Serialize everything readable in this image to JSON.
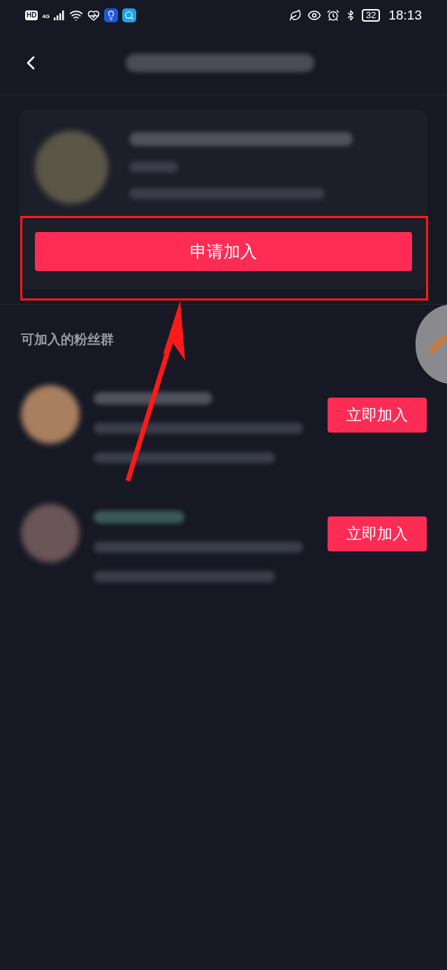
{
  "status_bar": {
    "hd_badge": "HD",
    "network_type": "4G",
    "battery": "32",
    "time": "18:13"
  },
  "group_card": {
    "join_button": "申请加入"
  },
  "section_title": "可加入的粉丝群",
  "groups": [
    {
      "join_button": "立即加入"
    },
    {
      "join_button": "立即加入"
    }
  ]
}
